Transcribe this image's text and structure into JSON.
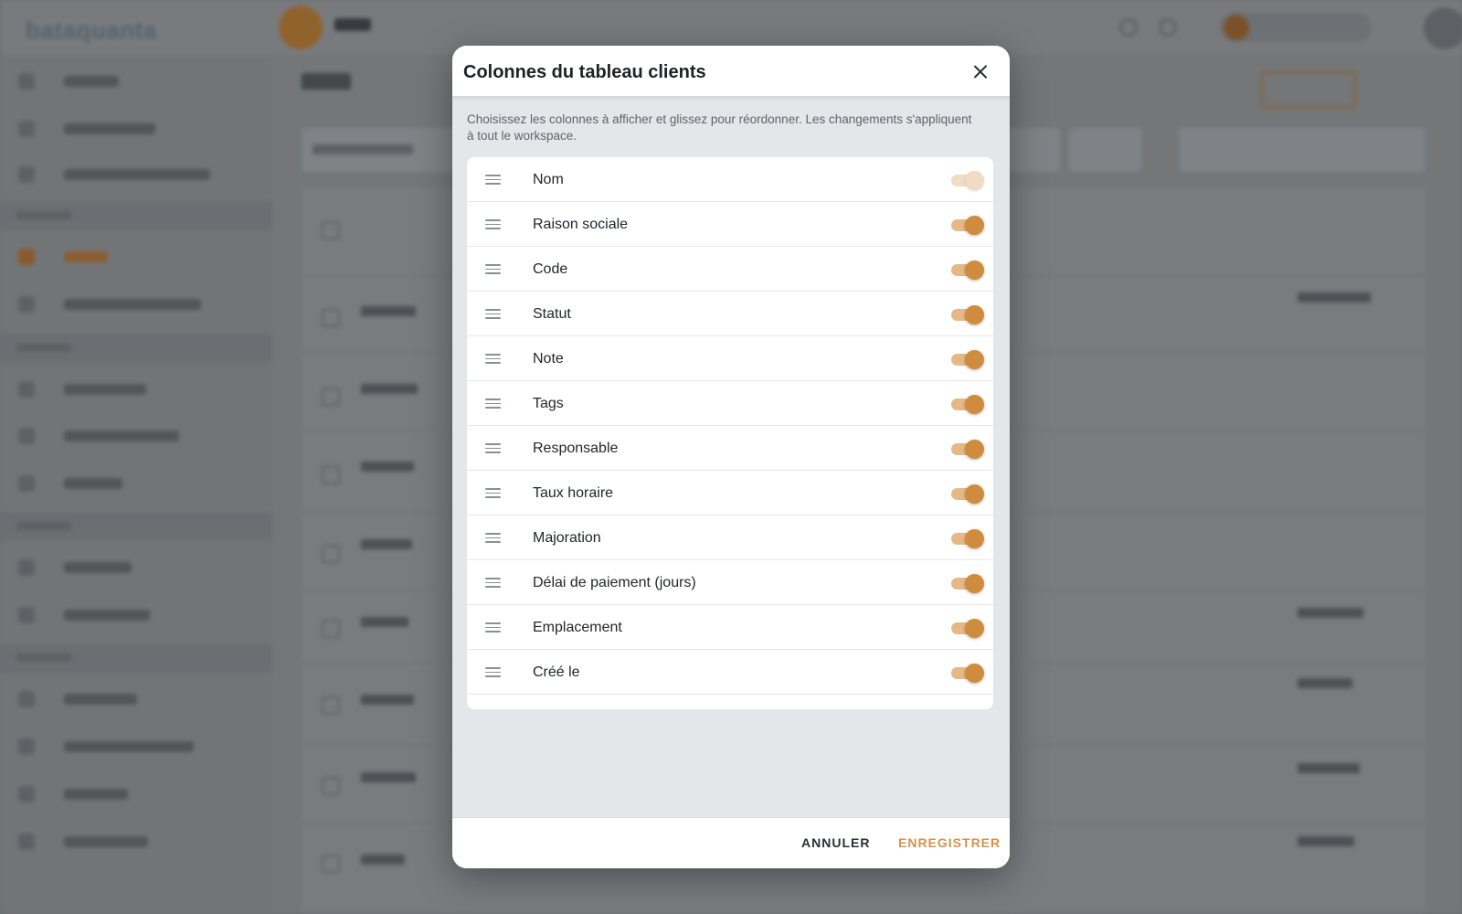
{
  "background_app": {
    "logo_text": "bataquanta"
  },
  "modal": {
    "title": "Colonnes du tableau clients",
    "description": "Choisissez les colonnes à afficher et glissez pour réordonner. Les changements s'appliquent à tout le workspace.",
    "close_icon": "close-icon",
    "drag_icon": "drag-handle-icon",
    "columns": [
      {
        "label": "Nom",
        "enabled": true,
        "locked": true
      },
      {
        "label": "Raison sociale",
        "enabled": true,
        "locked": false
      },
      {
        "label": "Code",
        "enabled": true,
        "locked": false
      },
      {
        "label": "Statut",
        "enabled": true,
        "locked": false
      },
      {
        "label": "Note",
        "enabled": true,
        "locked": false
      },
      {
        "label": "Tags",
        "enabled": true,
        "locked": false
      },
      {
        "label": "Responsable",
        "enabled": true,
        "locked": false
      },
      {
        "label": "Taux horaire",
        "enabled": true,
        "locked": false
      },
      {
        "label": "Majoration",
        "enabled": true,
        "locked": false
      },
      {
        "label": "Délai de paiement (jours)",
        "enabled": true,
        "locked": false
      },
      {
        "label": "Emplacement",
        "enabled": true,
        "locked": false
      },
      {
        "label": "Créé le",
        "enabled": true,
        "locked": false
      }
    ],
    "footer": {
      "cancel_label": "ANNULER",
      "save_label": "ENREGISTRER"
    },
    "colors": {
      "accent": "#d4934d",
      "toggle_thumb": "#cf8b3e",
      "toggle_track": "#e7b887"
    }
  }
}
